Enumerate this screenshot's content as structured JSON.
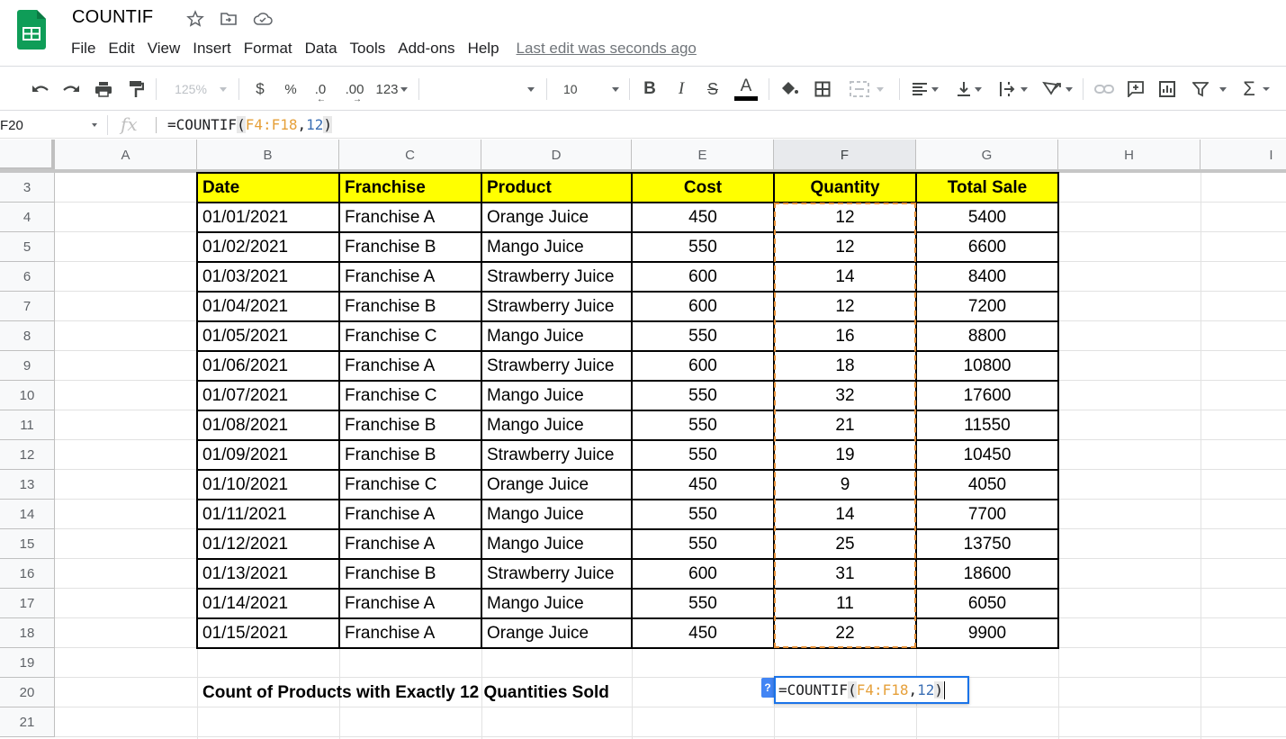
{
  "app": {
    "title": "COUNTIF",
    "last_edit": "Last edit was seconds ago",
    "colors": {
      "brand": "#0f9d58",
      "header_fill": "#ffff00",
      "range_highlight": "#e69138",
      "editor_border": "#1a73e8",
      "ref_color": "#e6a03a",
      "num_color": "#3c6fb4"
    }
  },
  "title_icons": [
    "star-icon",
    "move-to-folder-icon",
    "cloud-saved-icon"
  ],
  "menu": [
    "File",
    "Edit",
    "View",
    "Insert",
    "Format",
    "Data",
    "Tools",
    "Add-ons",
    "Help"
  ],
  "toolbar": {
    "zoom": "125%",
    "currency": "$",
    "percent": "%",
    "decrease_decimal": ".0",
    "increase_decimal": ".00",
    "more_formats": "123",
    "font": "",
    "font_size": "10",
    "bold": "B",
    "italic": "I",
    "strikethrough": "S",
    "text_color": "A"
  },
  "formula_bar": {
    "name_box": "F20",
    "fx": "fx",
    "prefix": "=COUNTIF",
    "open": "(",
    "ref": "F4:F18",
    "comma": ",",
    "criterion": "12",
    "close": ")"
  },
  "grid": {
    "columns": [
      "A",
      "B",
      "C",
      "D",
      "E",
      "F",
      "G",
      "H",
      "I"
    ],
    "rows": [
      "3",
      "4",
      "5",
      "6",
      "7",
      "8",
      "9",
      "10",
      "11",
      "12",
      "13",
      "14",
      "15",
      "16",
      "17",
      "18",
      "19",
      "20",
      "21"
    ],
    "selected_column": "F",
    "table": {
      "headers": [
        "Date",
        "Franchise",
        "Product",
        "Cost",
        "Quantity",
        "Total Sale"
      ],
      "rows": [
        [
          "01/01/2021",
          "Franchise A",
          "Orange Juice",
          "450",
          "12",
          "5400"
        ],
        [
          "01/02/2021",
          "Franchise B",
          "Mango Juice",
          "550",
          "12",
          "6600"
        ],
        [
          "01/03/2021",
          "Franchise A",
          "Strawberry Juice",
          "600",
          "14",
          "8400"
        ],
        [
          "01/04/2021",
          "Franchise B",
          "Strawberry Juice",
          "600",
          "12",
          "7200"
        ],
        [
          "01/05/2021",
          "Franchise C",
          "Mango Juice",
          "550",
          "16",
          "8800"
        ],
        [
          "01/06/2021",
          "Franchise A",
          "Strawberry Juice",
          "600",
          "18",
          "10800"
        ],
        [
          "01/07/2021",
          "Franchise C",
          "Mango Juice",
          "550",
          "32",
          "17600"
        ],
        [
          "01/08/2021",
          "Franchise B",
          "Mango Juice",
          "550",
          "21",
          "11550"
        ],
        [
          "01/09/2021",
          "Franchise B",
          "Strawberry Juice",
          "550",
          "19",
          "10450"
        ],
        [
          "01/10/2021",
          "Franchise C",
          "Orange Juice",
          "450",
          "9",
          "4050"
        ],
        [
          "01/11/2021",
          "Franchise A",
          "Mango Juice",
          "550",
          "14",
          "7700"
        ],
        [
          "01/12/2021",
          "Franchise A",
          "Mango Juice",
          "550",
          "25",
          "13750"
        ],
        [
          "01/13/2021",
          "Franchise B",
          "Strawberry Juice",
          "600",
          "31",
          "18600"
        ],
        [
          "01/14/2021",
          "Franchise A",
          "Mango Juice",
          "550",
          "11",
          "6050"
        ],
        [
          "01/15/2021",
          "Franchise A",
          "Orange Juice",
          "450",
          "22",
          "9900"
        ]
      ]
    },
    "row20_label": "Count of Products with Exactly 12 Quantities Sold",
    "editor": {
      "help": "?",
      "prefix": "=COUNTIF",
      "open": "(",
      "ref": "F4:F18",
      "comma": ",",
      "criterion": "12",
      "close": ")"
    }
  }
}
